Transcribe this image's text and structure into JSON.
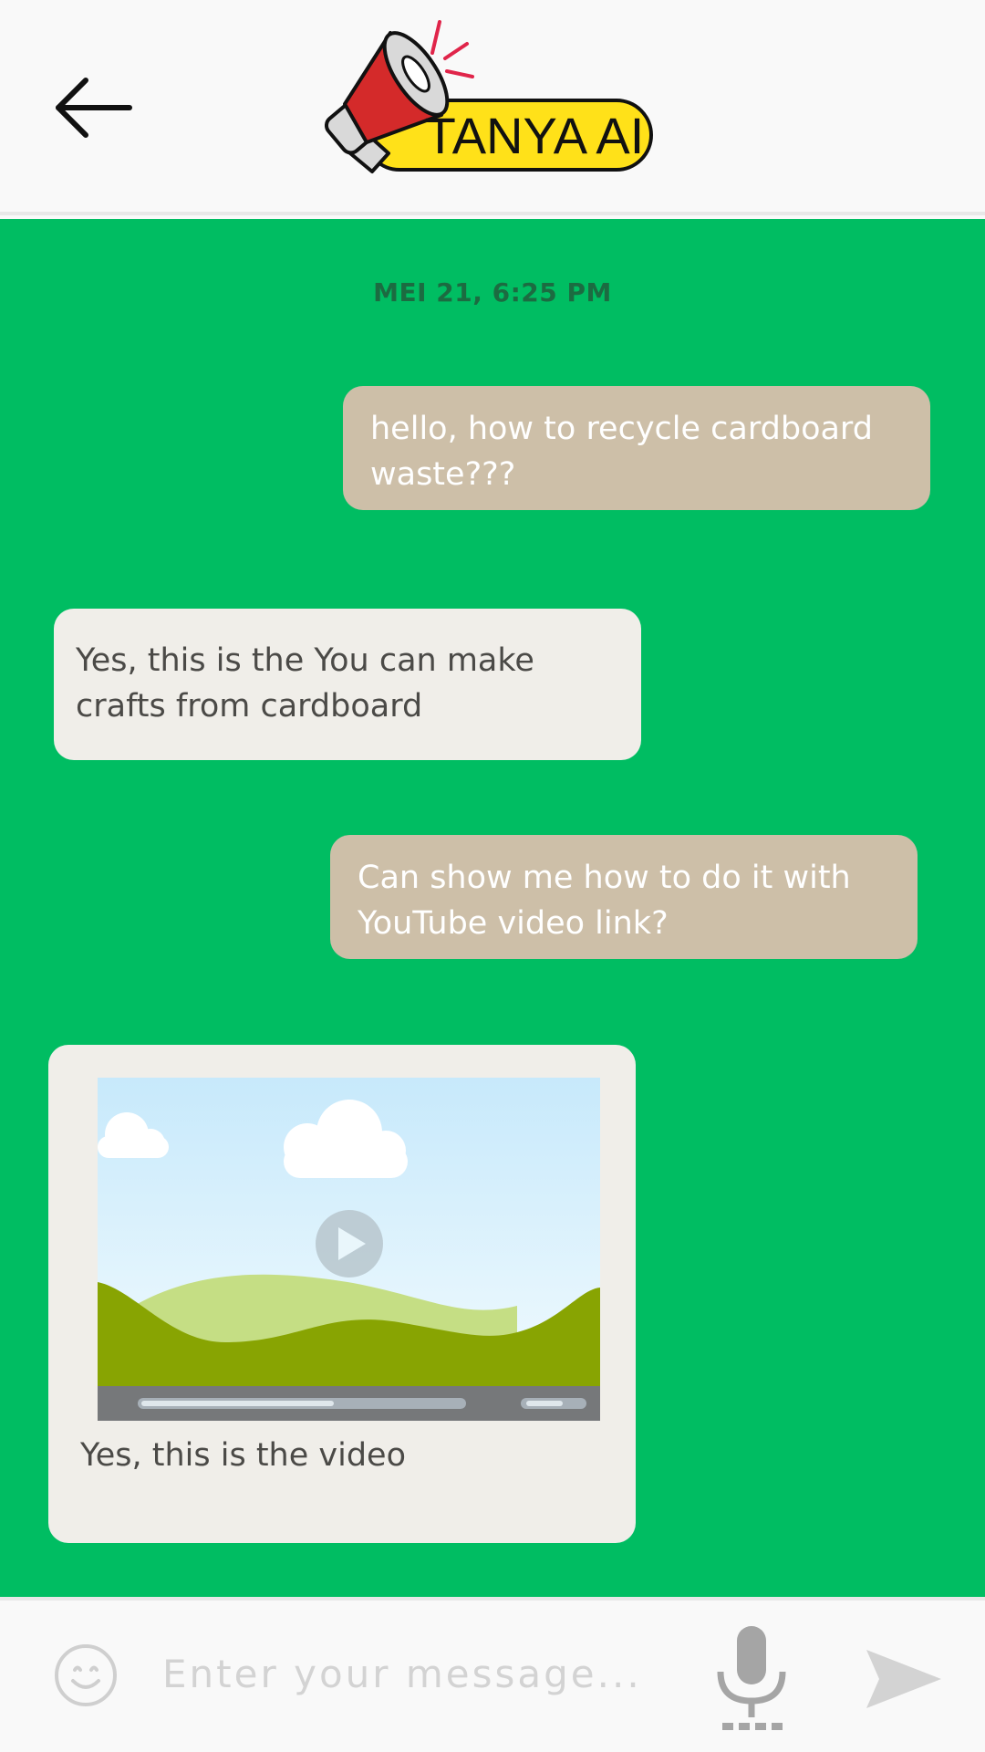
{
  "header": {
    "back_icon": "arrow-left-icon",
    "logo_text": "TANYA AI",
    "logo_colors": {
      "badge": "#ffe119",
      "megaphone": "#d42a2a",
      "accent": "#e0254a"
    }
  },
  "chat": {
    "background": "#00bd62",
    "timestamp": "MEI 21, 6:25 PM",
    "messages": [
      {
        "sender": "user",
        "text": "hello, how to recycle cardboard waste???"
      },
      {
        "sender": "bot",
        "text": "Yes, this is the You can make crafts from cardboard"
      },
      {
        "sender": "user",
        "text": "Can show me how to do it with YouTube video link?"
      },
      {
        "sender": "bot",
        "type": "video",
        "caption": "Yes, this is the video",
        "progress": 0.6
      }
    ]
  },
  "input_bar": {
    "emoji_icon": "smiley-icon",
    "placeholder": "Enter your message...",
    "mic_icon": "microphone-icon",
    "send_icon": "send-icon"
  }
}
